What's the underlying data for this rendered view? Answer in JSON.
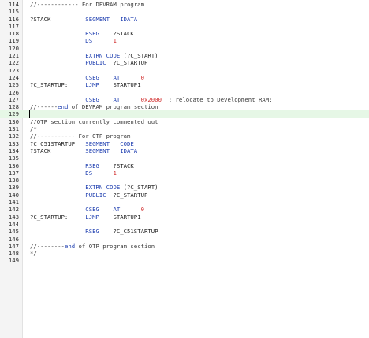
{
  "editor": {
    "colors": {
      "keyword": "#1f3fb0",
      "number": "#d12f2f",
      "text": "#1e1e1e",
      "current_line": "#e6f7e6"
    },
    "current_line_number": "129",
    "lines": [
      {
        "n": "114",
        "c": [
          [
            "cm",
            "//------------ For DEVRAM program"
          ]
        ]
      },
      {
        "n": "115",
        "c": []
      },
      {
        "n": "116",
        "c": [
          [
            "tx",
            "?STACK          "
          ],
          [
            "kw",
            "SEGMENT   IDATA"
          ]
        ]
      },
      {
        "n": "117",
        "c": []
      },
      {
        "n": "118",
        "c": [
          [
            "tx",
            "                "
          ],
          [
            "kw",
            "RSEG"
          ],
          [
            "tx",
            "    ?STACK"
          ]
        ]
      },
      {
        "n": "119",
        "c": [
          [
            "tx",
            "                "
          ],
          [
            "kw",
            "DS"
          ],
          [
            "tx",
            "      "
          ],
          [
            "num",
            "1"
          ]
        ]
      },
      {
        "n": "120",
        "c": []
      },
      {
        "n": "121",
        "c": [
          [
            "tx",
            "                "
          ],
          [
            "kw",
            "EXTRN CODE"
          ],
          [
            "tx",
            " (?C_START)"
          ]
        ]
      },
      {
        "n": "122",
        "c": [
          [
            "tx",
            "                "
          ],
          [
            "kw",
            "PUBLIC"
          ],
          [
            "tx",
            "  ?C_STARTUP"
          ]
        ]
      },
      {
        "n": "123",
        "c": []
      },
      {
        "n": "124",
        "c": [
          [
            "tx",
            "                "
          ],
          [
            "kw",
            "CSEG"
          ],
          [
            "tx",
            "    "
          ],
          [
            "kw",
            "AT"
          ],
          [
            "tx",
            "      "
          ],
          [
            "num",
            "0"
          ]
        ]
      },
      {
        "n": "125",
        "c": [
          [
            "tx",
            "?C_STARTUP:     "
          ],
          [
            "kw",
            "LJMP"
          ],
          [
            "tx",
            "    STARTUP1"
          ]
        ]
      },
      {
        "n": "126",
        "c": []
      },
      {
        "n": "127",
        "c": [
          [
            "tx",
            "                "
          ],
          [
            "kw",
            "CSEG"
          ],
          [
            "tx",
            "    "
          ],
          [
            "kw",
            "AT"
          ],
          [
            "tx",
            "      "
          ],
          [
            "num",
            "0x2000"
          ],
          [
            "cm",
            "  ; relocate to Development RAM;"
          ]
        ]
      },
      {
        "n": "128",
        "c": [
          [
            "cm",
            "//------"
          ],
          [
            "kw",
            "end"
          ],
          [
            "cm",
            " of DEVRAM program section"
          ]
        ]
      },
      {
        "n": "129",
        "c": []
      },
      {
        "n": "130",
        "c": [
          [
            "cm",
            "//OTP section currently commented out"
          ]
        ]
      },
      {
        "n": "131",
        "c": [
          [
            "cm",
            "/*"
          ]
        ]
      },
      {
        "n": "132",
        "c": [
          [
            "cm",
            "//----------- For OTP program"
          ]
        ]
      },
      {
        "n": "133",
        "c": [
          [
            "tx",
            "?C_C51STARTUP   "
          ],
          [
            "kw",
            "SEGMENT   CODE"
          ]
        ]
      },
      {
        "n": "134",
        "c": [
          [
            "tx",
            "?STACK          "
          ],
          [
            "kw",
            "SEGMENT   IDATA"
          ]
        ]
      },
      {
        "n": "135",
        "c": []
      },
      {
        "n": "136",
        "c": [
          [
            "tx",
            "                "
          ],
          [
            "kw",
            "RSEG"
          ],
          [
            "tx",
            "    ?STACK"
          ]
        ]
      },
      {
        "n": "137",
        "c": [
          [
            "tx",
            "                "
          ],
          [
            "kw",
            "DS"
          ],
          [
            "tx",
            "      "
          ],
          [
            "num",
            "1"
          ]
        ]
      },
      {
        "n": "138",
        "c": []
      },
      {
        "n": "139",
        "c": [
          [
            "tx",
            "                "
          ],
          [
            "kw",
            "EXTRN CODE"
          ],
          [
            "tx",
            " (?C_START)"
          ]
        ]
      },
      {
        "n": "140",
        "c": [
          [
            "tx",
            "                "
          ],
          [
            "kw",
            "PUBLIC"
          ],
          [
            "tx",
            "  ?C_STARTUP"
          ]
        ]
      },
      {
        "n": "141",
        "c": []
      },
      {
        "n": "142",
        "c": [
          [
            "tx",
            "                "
          ],
          [
            "kw",
            "CSEG"
          ],
          [
            "tx",
            "    "
          ],
          [
            "kw",
            "AT"
          ],
          [
            "tx",
            "      "
          ],
          [
            "num",
            "0"
          ]
        ]
      },
      {
        "n": "143",
        "c": [
          [
            "tx",
            "?C_STARTUP:     "
          ],
          [
            "kw",
            "LJMP"
          ],
          [
            "tx",
            "    STARTUP1"
          ]
        ]
      },
      {
        "n": "144",
        "c": []
      },
      {
        "n": "145",
        "c": [
          [
            "tx",
            "                "
          ],
          [
            "kw",
            "RSEG"
          ],
          [
            "tx",
            "    ?C_C51STARTUP"
          ]
        ]
      },
      {
        "n": "146",
        "c": []
      },
      {
        "n": "147",
        "c": [
          [
            "cm",
            "//--------"
          ],
          [
            "kw",
            "end"
          ],
          [
            "cm",
            " of OTP program section"
          ]
        ]
      },
      {
        "n": "148",
        "c": [
          [
            "cm",
            "*/"
          ]
        ]
      },
      {
        "n": "149",
        "c": []
      }
    ]
  }
}
